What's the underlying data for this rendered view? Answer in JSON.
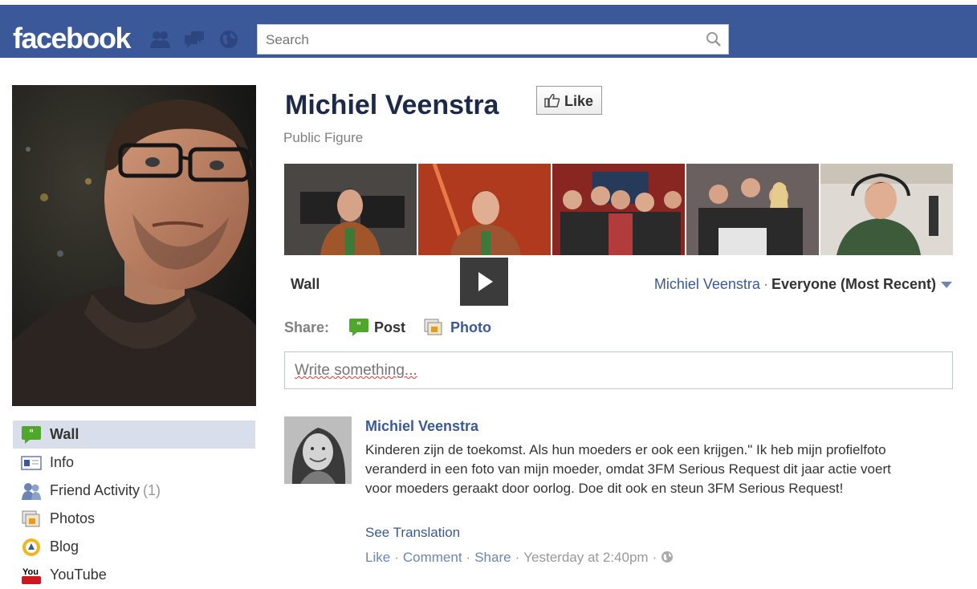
{
  "header": {
    "logo": "facebook",
    "search_placeholder": "Search",
    "jewels": [
      "friend-requests-icon",
      "messages-icon",
      "notifications-icon"
    ],
    "colors": {
      "bar": "#3b5998",
      "link": "#3b5998"
    }
  },
  "profile": {
    "name": "Michiel Veenstra",
    "like_label": "Like",
    "category": "Public Figure"
  },
  "sidebar": {
    "items": [
      {
        "label": "Wall",
        "icon": "wall-icon",
        "active": true
      },
      {
        "label": "Info",
        "icon": "info-icon"
      },
      {
        "label": "Friend Activity",
        "count": "(1)",
        "icon": "friends-icon"
      },
      {
        "label": "Photos",
        "icon": "photos-icon"
      },
      {
        "label": "Blog",
        "icon": "blog-icon"
      },
      {
        "label": "YouTube",
        "icon": "youtube-icon"
      }
    ]
  },
  "wall": {
    "title": "Wall",
    "filter_name": "Michiel Veenstra",
    "filter_sep": "·",
    "filter_value": "Everyone (Most Recent)"
  },
  "share": {
    "label": "Share:",
    "post": "Post",
    "photo": "Photo"
  },
  "composer": {
    "placeholder": "Write something..."
  },
  "story": {
    "author": "Michiel Veenstra",
    "message": "Kinderen zijn de toekomst. Als hun moeders er ook een krijgen.\" Ik heb mijn profielfoto veranderd in een foto van mijn moeder, omdat 3FM Serious Request dit jaar actie voert voor moeders geraakt door oorlog. Doe dit ook en steun 3FM Serious Request!",
    "translate": "See Translation",
    "like": "Like",
    "comment": "Comment",
    "share": "Share",
    "time": "Yesterday at 2:40pm",
    "sep": "·"
  }
}
